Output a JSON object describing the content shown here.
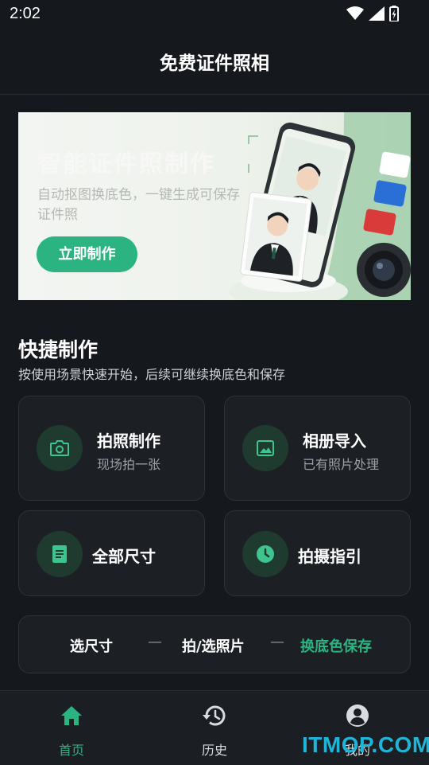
{
  "status_bar": {
    "time": "2:02"
  },
  "header": {
    "title": "免费证件照相"
  },
  "banner": {
    "headline": "智能证件照制作",
    "description": "自动抠图换底色，一键生成可保存证件照",
    "button_label": "立即制作"
  },
  "quick": {
    "title": "快捷制作",
    "subtitle": "按使用场景快速开始，后续可继续换底色和保存",
    "cards": [
      {
        "title": "拍照制作",
        "subtitle": "现场拍一张",
        "icon": "camera-icon"
      },
      {
        "title": "相册导入",
        "subtitle": "已有照片处理",
        "icon": "image-icon"
      },
      {
        "title": "全部尺寸",
        "icon": "document-icon"
      },
      {
        "title": "拍摄指引",
        "icon": "clock-icon"
      }
    ]
  },
  "steps": {
    "step1": "选尺寸",
    "sep1": "—",
    "step2": "拍/选照片",
    "sep2": "—",
    "step3": "换底色保存"
  },
  "nav": {
    "home": "首页",
    "history": "历史",
    "mine": "我的"
  },
  "watermark": "ITMOP.COM",
  "colors": {
    "accent": "#2bb482",
    "background": "#15181c",
    "card": "#1c2025"
  }
}
